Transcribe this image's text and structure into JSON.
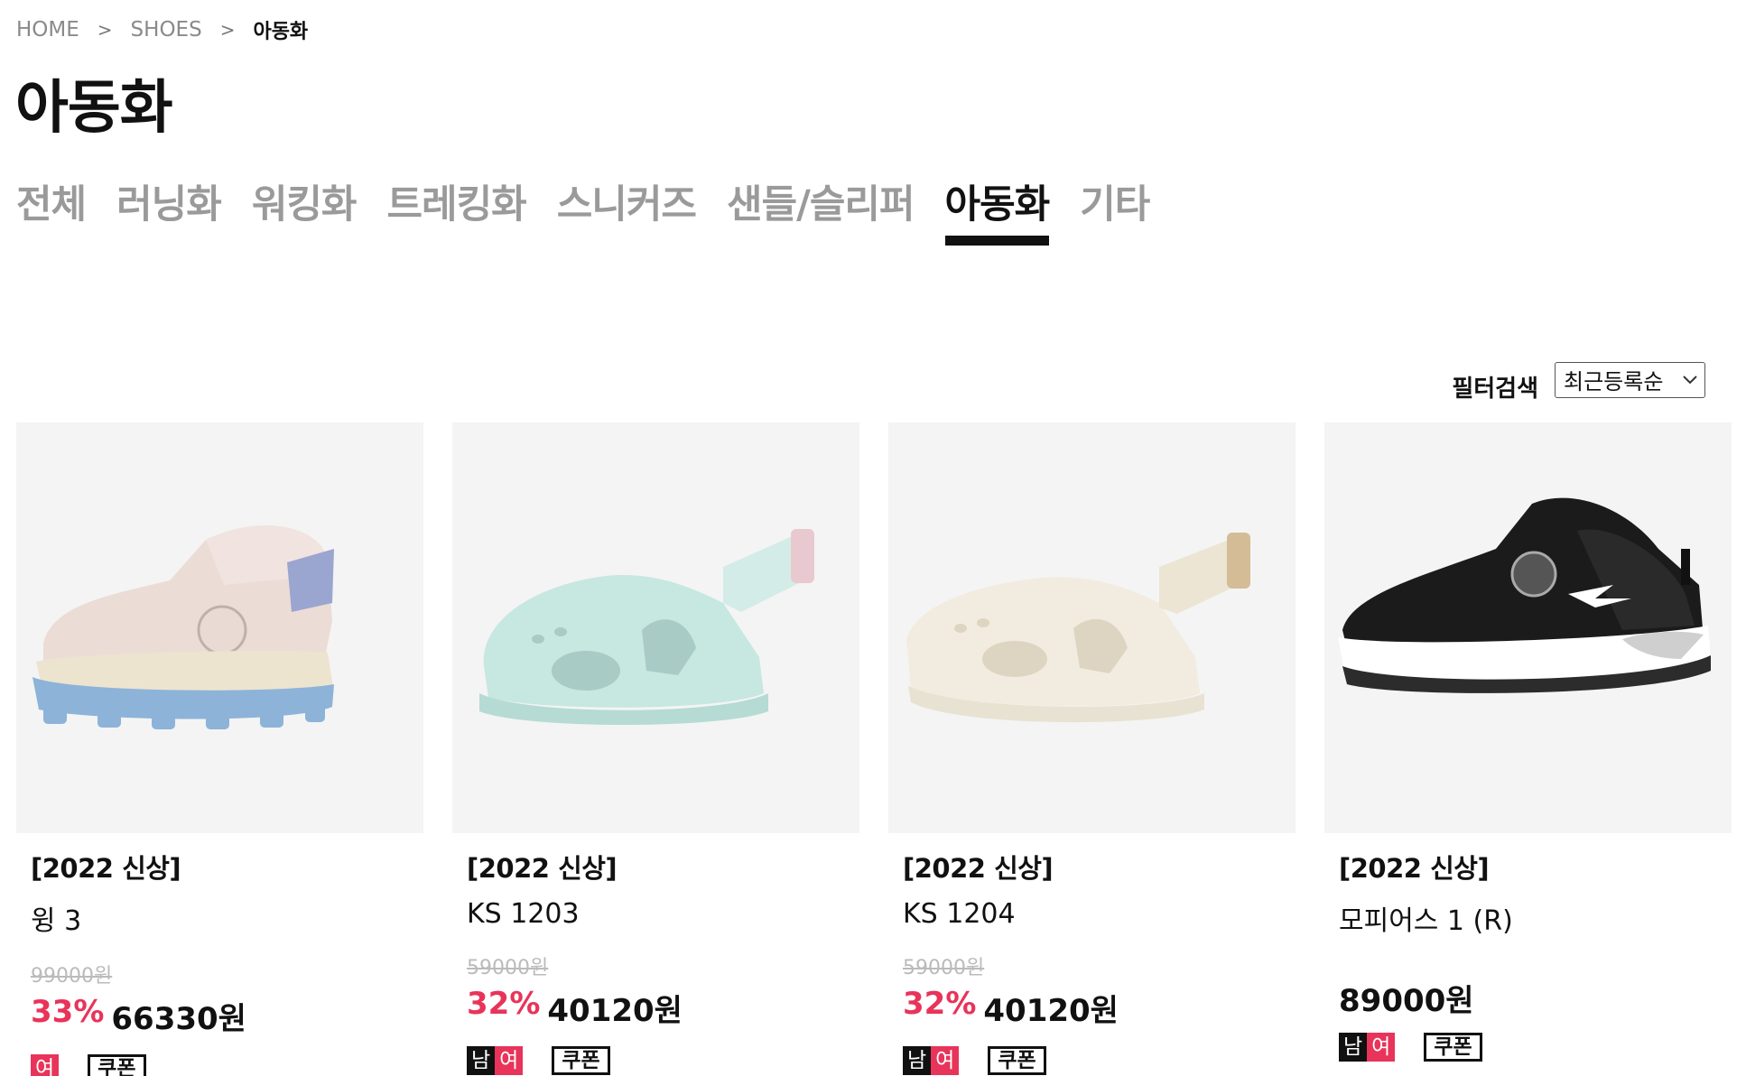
{
  "breadcrumb": {
    "home": "HOME",
    "category": "SHOES",
    "current": "아동화",
    "separator": ">"
  },
  "page_title": "아동화",
  "tabs": [
    {
      "label": "전체"
    },
    {
      "label": "러닝화"
    },
    {
      "label": "워킹화"
    },
    {
      "label": "트레킹화"
    },
    {
      "label": "스니커즈"
    },
    {
      "label": "샌들/슬리퍼"
    },
    {
      "label": "아동화",
      "active": true
    },
    {
      "label": "기타"
    }
  ],
  "toolbar": {
    "filter_label": "필터검색",
    "sort_value": "최근등록순",
    "sort_icon": "chevron-down-icon"
  },
  "colors": {
    "accent": "#e8345a",
    "text": "#111111",
    "muted": "#9a9a9a",
    "thumb_bg": "#f4f4f4"
  },
  "products": [
    {
      "tag": "[2022 신상]",
      "name": "윙 3",
      "old_price": "99000원",
      "discount": "33%",
      "price": "66330원",
      "gender": [
        "여"
      ],
      "coupon": "쿠폰"
    },
    {
      "tag": "[2022 신상]",
      "name": "KS 1203",
      "old_price": "59000원",
      "discount": "32%",
      "price": "40120원",
      "gender": [
        "남",
        "여"
      ],
      "coupon": "쿠폰"
    },
    {
      "tag": "[2022 신상]",
      "name": "KS 1204",
      "old_price": "59000원",
      "discount": "32%",
      "price": "40120원",
      "gender": [
        "남",
        "여"
      ],
      "coupon": "쿠폰"
    },
    {
      "tag": "[2022 신상]",
      "name": "모피어스 1 (R)",
      "price": "89000원",
      "gender": [
        "남",
        "여"
      ],
      "coupon": "쿠폰"
    }
  ]
}
